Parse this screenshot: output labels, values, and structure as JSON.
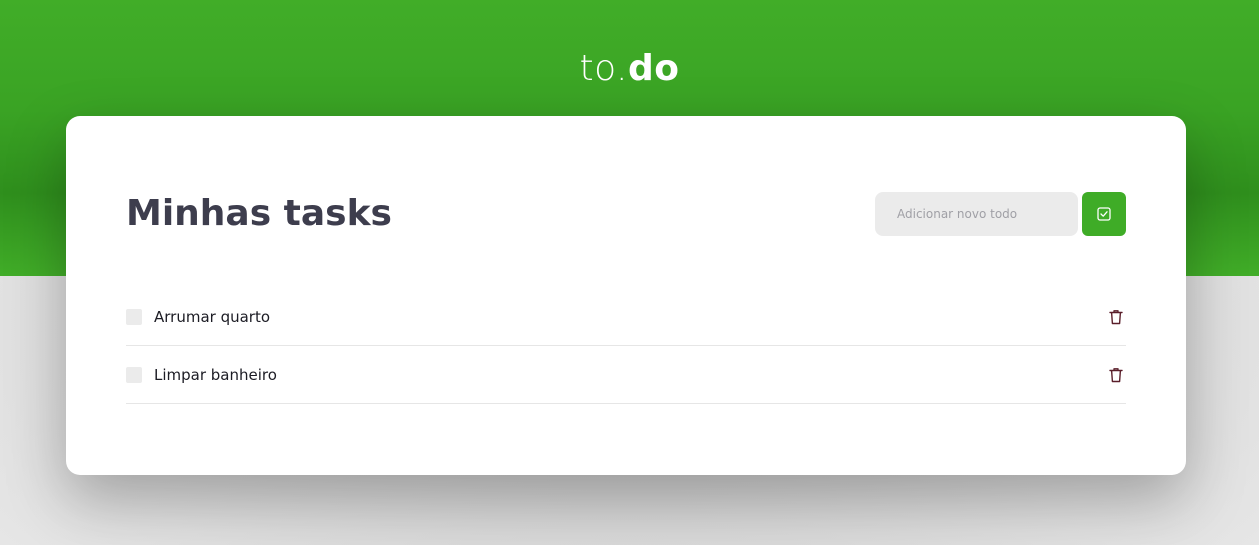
{
  "brand": {
    "light_part": "to.",
    "bold_part": "do"
  },
  "main": {
    "title": "Minhas tasks",
    "input": {
      "placeholder": "Adicionar novo todo",
      "value": ""
    },
    "add_button_icon": "check-square-icon"
  },
  "tasks": [
    {
      "label": "Arrumar quarto",
      "done": false,
      "delete_icon": "trash-icon"
    },
    {
      "label": "Limpar banheiro",
      "done": false,
      "delete_icon": "trash-icon"
    }
  ],
  "colors": {
    "brand_green": "#41ad28",
    "title_text": "#3d3d4d",
    "input_bg": "#ebebeb",
    "trash_icon": "#5a1e2a"
  }
}
